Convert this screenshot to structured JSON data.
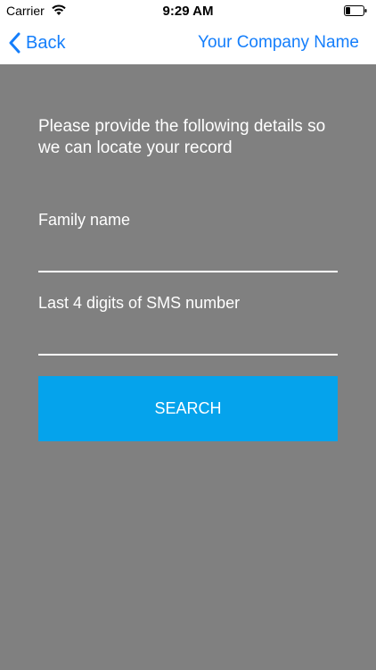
{
  "status_bar": {
    "carrier": "Carrier",
    "time": "9:29 AM",
    "wifi_icon": "wifi-icon",
    "battery_icon": "battery-icon",
    "battery_level": 0.25
  },
  "nav": {
    "back_label": "Back",
    "back_icon": "chevron-left-icon",
    "company_name": "Your Company Name",
    "accent_color": "#147efb"
  },
  "form": {
    "instructions": "Please provide the following details so we can locate your record",
    "family_name_label": "Family name",
    "family_name_value": "",
    "sms_label": "Last 4 digits of SMS number",
    "sms_value": "",
    "search_label": "SEARCH",
    "background_color": "#808080",
    "button_color": "#05a3ec"
  }
}
